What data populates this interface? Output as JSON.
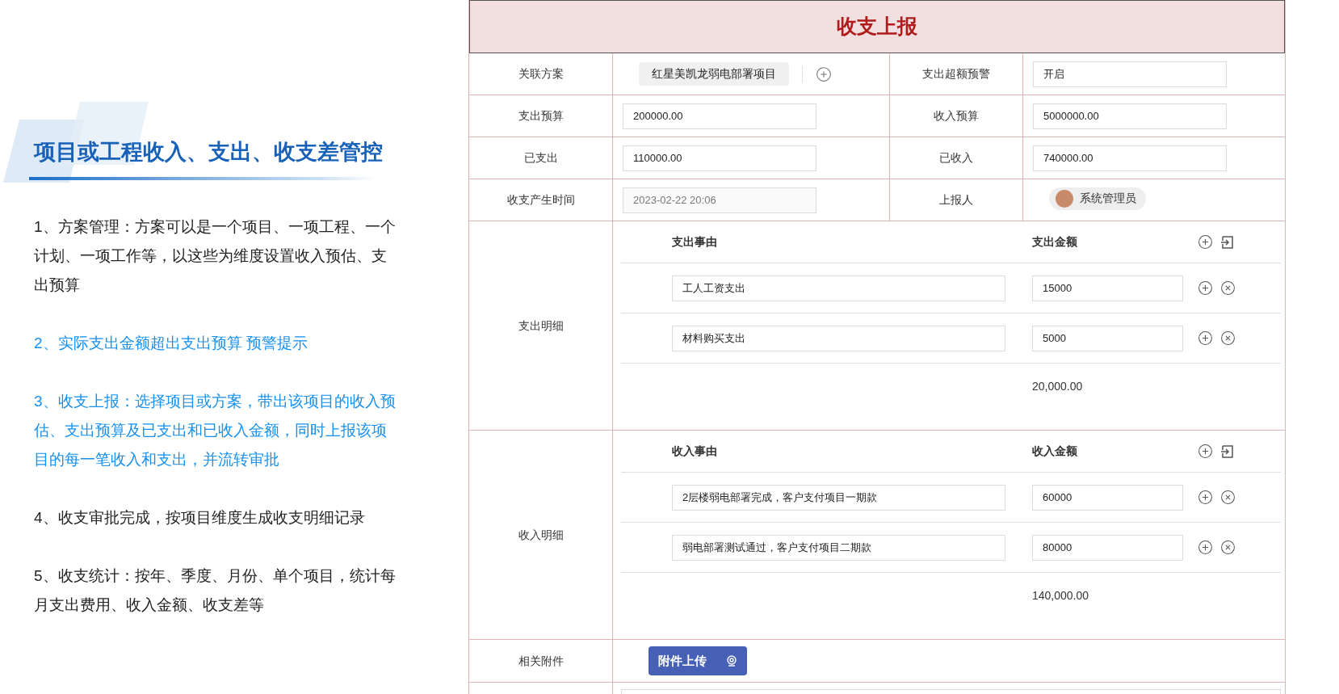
{
  "intro": {
    "title": "项目或工程收入、支出、收支差管控",
    "points": [
      {
        "text": "1、方案管理：方案可以是一个项目、一项工程、一个计划、一项工作等，以这些为维度设置收入预估、支出预算",
        "highlighted": false
      },
      {
        "text": "2、实际支出金额超出支出预算 预警提示",
        "highlighted": true
      },
      {
        "text": "3、收支上报：选择项目或方案，带出该项目的收入预估、支出预算及已支出和已收入金额，同时上报该项目的每一笔收入和支出，并流转审批",
        "highlighted": true
      },
      {
        "text": "4、收支审批完成，按项目维度生成收支明细记录",
        "highlighted": false
      },
      {
        "text": "5、收支统计：按年、季度、月份、单个项目，统计每月支出费用、收入金额、收支差等",
        "highlighted": false
      }
    ]
  },
  "form": {
    "title": "收支上报",
    "rows": [
      [
        {
          "label": "关联方案",
          "kind": "tag",
          "value": "红星美凯龙弱电部署项目"
        },
        {
          "label": "支出超额预警",
          "kind": "input",
          "value": "开启",
          "disabled": false
        }
      ],
      [
        {
          "label": "支出预算",
          "kind": "input",
          "value": "200000.00",
          "disabled": false
        },
        {
          "label": "收入预算",
          "kind": "input",
          "value": "5000000.00",
          "disabled": false
        }
      ],
      [
        {
          "label": "已支出",
          "kind": "input",
          "value": "110000.00",
          "disabled": false
        },
        {
          "label": "已收入",
          "kind": "input",
          "value": "740000.00",
          "disabled": false
        }
      ],
      [
        {
          "label": "收支产生时间",
          "kind": "input",
          "value": "2023-02-22 20:06",
          "disabled": true
        },
        {
          "label": "上报人",
          "kind": "user",
          "value": "系统管理员"
        }
      ]
    ],
    "sections": [
      {
        "label": "支出明细",
        "columns": [
          "支出事由",
          "支出金额"
        ],
        "rows": [
          {
            "reason": "工人工资支出",
            "amount": "15000"
          },
          {
            "reason": "材料购买支出",
            "amount": "5000"
          }
        ],
        "total": "20,000.00"
      },
      {
        "label": "收入明细",
        "columns": [
          "收入事由",
          "收入金额"
        ],
        "rows": [
          {
            "reason": "2层楼弱电部署完成，客户支付项目一期款",
            "amount": "60000"
          },
          {
            "reason": "弱电部署测试通过，客户支付项目二期款",
            "amount": "80000"
          }
        ],
        "total": "140,000.00"
      }
    ],
    "attachment": {
      "label": "相关附件",
      "button": "附件上传"
    }
  }
}
